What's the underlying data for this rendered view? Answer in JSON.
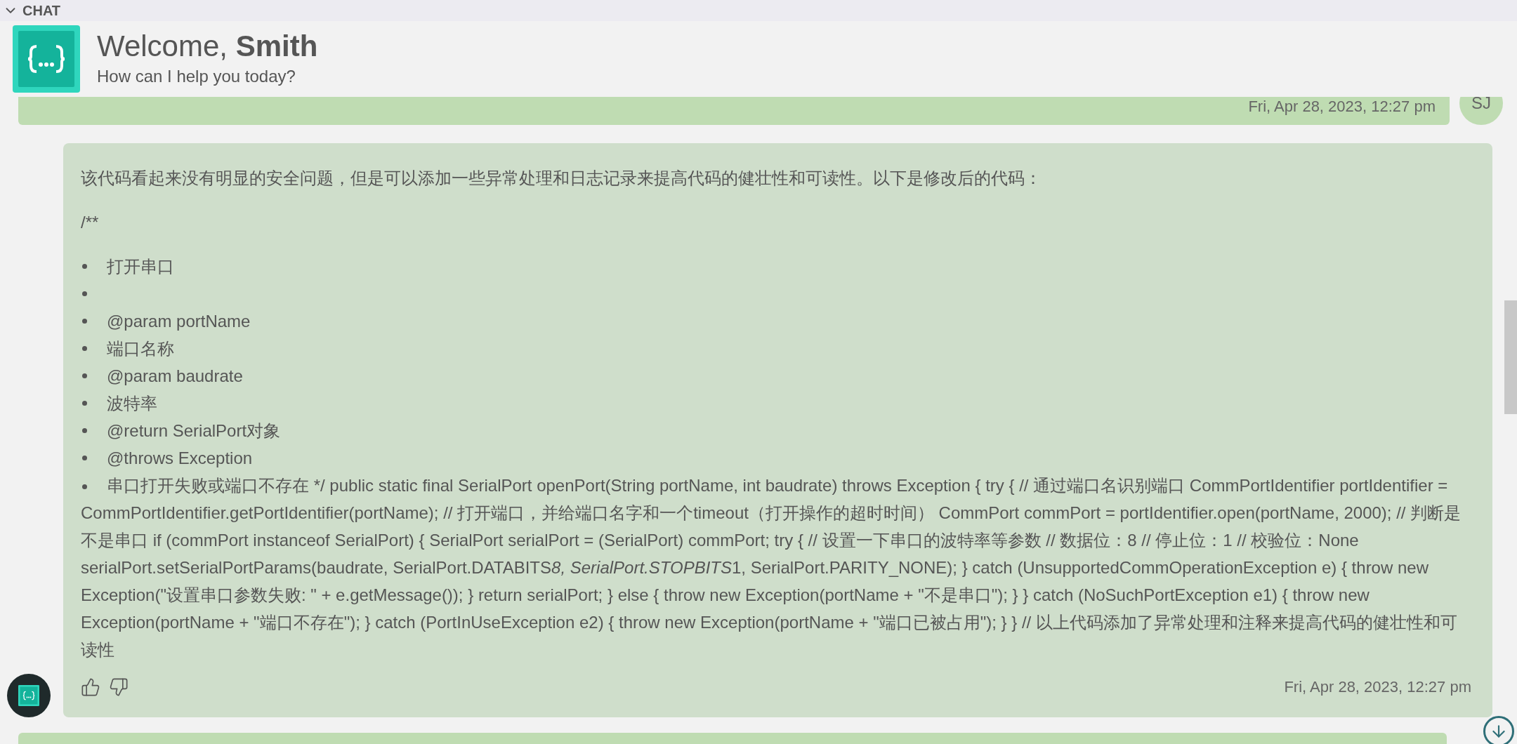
{
  "panel": {
    "title": "CHAT",
    "expanded": true
  },
  "welcome": {
    "greeting": "Welcome,",
    "name": "Smith",
    "subtitle": "How can I help you today?"
  },
  "messages": [
    {
      "kind": "user",
      "avatar": "SJ",
      "timestamp": "Fri, Apr 28, 2023, 12:27 pm"
    },
    {
      "kind": "assistant",
      "intro": "该代码看起来没有明显的安全问题，但是可以添加一些异常处理和日志记录来提高代码的健壮性和可读性。以下是修改后的代码：",
      "comment_open": "/**",
      "bullets": [
        {
          "kind": "text",
          "text": "打开串口"
        },
        {
          "kind": "blank"
        },
        {
          "text": "@param portName"
        },
        {
          "text": "端口名称"
        },
        {
          "text": "@param baudrate"
        },
        {
          "text": "波特率"
        },
        {
          "text": "@return SerialPort对象"
        },
        {
          "text": "@throws Exception"
        },
        {
          "kind": "paragraph",
          "parts": [
            {
              "italic": false,
              "text": "串口打开失败或端口不存在 */ public static final SerialPort openPort(String portName, int baudrate) throws Exception { try { // 通过端口名识别端口 CommPortIdentifier portIdentifier = CommPortIdentifier.getPortIdentifier(portName); // 打开端口，并给端口名字和一个timeout（打开操作的超时时间） CommPort commPort = portIdentifier.open(portName, 2000); // 判断是不是串口 if (commPort instanceof SerialPort) { SerialPort serialPort = (SerialPort) commPort; try { // 设置一下串口的波特率等参数 // 数据位：8 // 停止位：1 // 校验位：None serialPort.setSerialPortParams(baudrate, SerialPort.DATABITS"
            },
            {
              "italic": true,
              "text": "8, SerialPort.STOPBITS"
            },
            {
              "italic": false,
              "text": "1, SerialPort.PARITY_NONE); } catch (UnsupportedCommOperationException e) { throw new Exception(\"设置串口参数失败: \" + e.getMessage()); } return serialPort; } else { throw new Exception(portName + \"不是串口\"); } } catch (NoSuchPortException e1) { throw new Exception(portName + \"端口不存在\"); } catch (PortInUseException e2) { throw new Exception(portName + \"端口已被占用\"); } } // 以上代码添加了异常处理和注释来提高代码的健壮性和可读性"
            }
          ]
        }
      ],
      "timestamp": "Fri, Apr 28, 2023, 12:27 pm"
    },
    {
      "kind": "user_partial"
    }
  ]
}
